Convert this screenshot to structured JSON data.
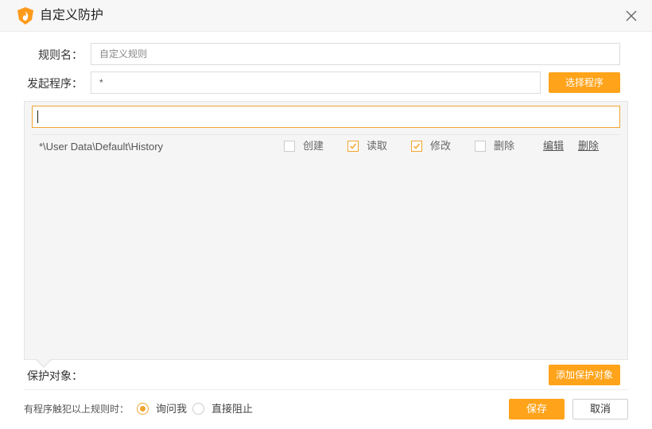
{
  "window": {
    "title": "自定义防护",
    "brand_color": "#ffa31a"
  },
  "form": {
    "rule_name_label": "规则名：",
    "rule_name_placeholder": "自定义规则",
    "process_label": "发起程序：",
    "process_value": "*",
    "select_process_button": "选择程序"
  },
  "rules": [
    {
      "path": "*\\User Data\\Default\\History",
      "create": {
        "label": "创建",
        "checked": false
      },
      "read": {
        "label": "读取",
        "checked": true
      },
      "modify": {
        "label": "修改",
        "checked": true
      },
      "delete": {
        "label": "删除",
        "checked": false
      },
      "edit_link": "编辑",
      "delete_link": "删除"
    }
  ],
  "protected": {
    "label": "保护对象：",
    "add_button": "添加保护对象"
  },
  "footer": {
    "prompt": "有程序触犯以上规则时：",
    "options": [
      {
        "label": "询问我",
        "selected": true
      },
      {
        "label": "直接阻止",
        "selected": false
      }
    ],
    "save_button": "保存",
    "cancel_button": "取消"
  },
  "icons": {
    "logo": "shield-flame-logo",
    "close": "close-icon",
    "check": "checkmark-icon"
  }
}
